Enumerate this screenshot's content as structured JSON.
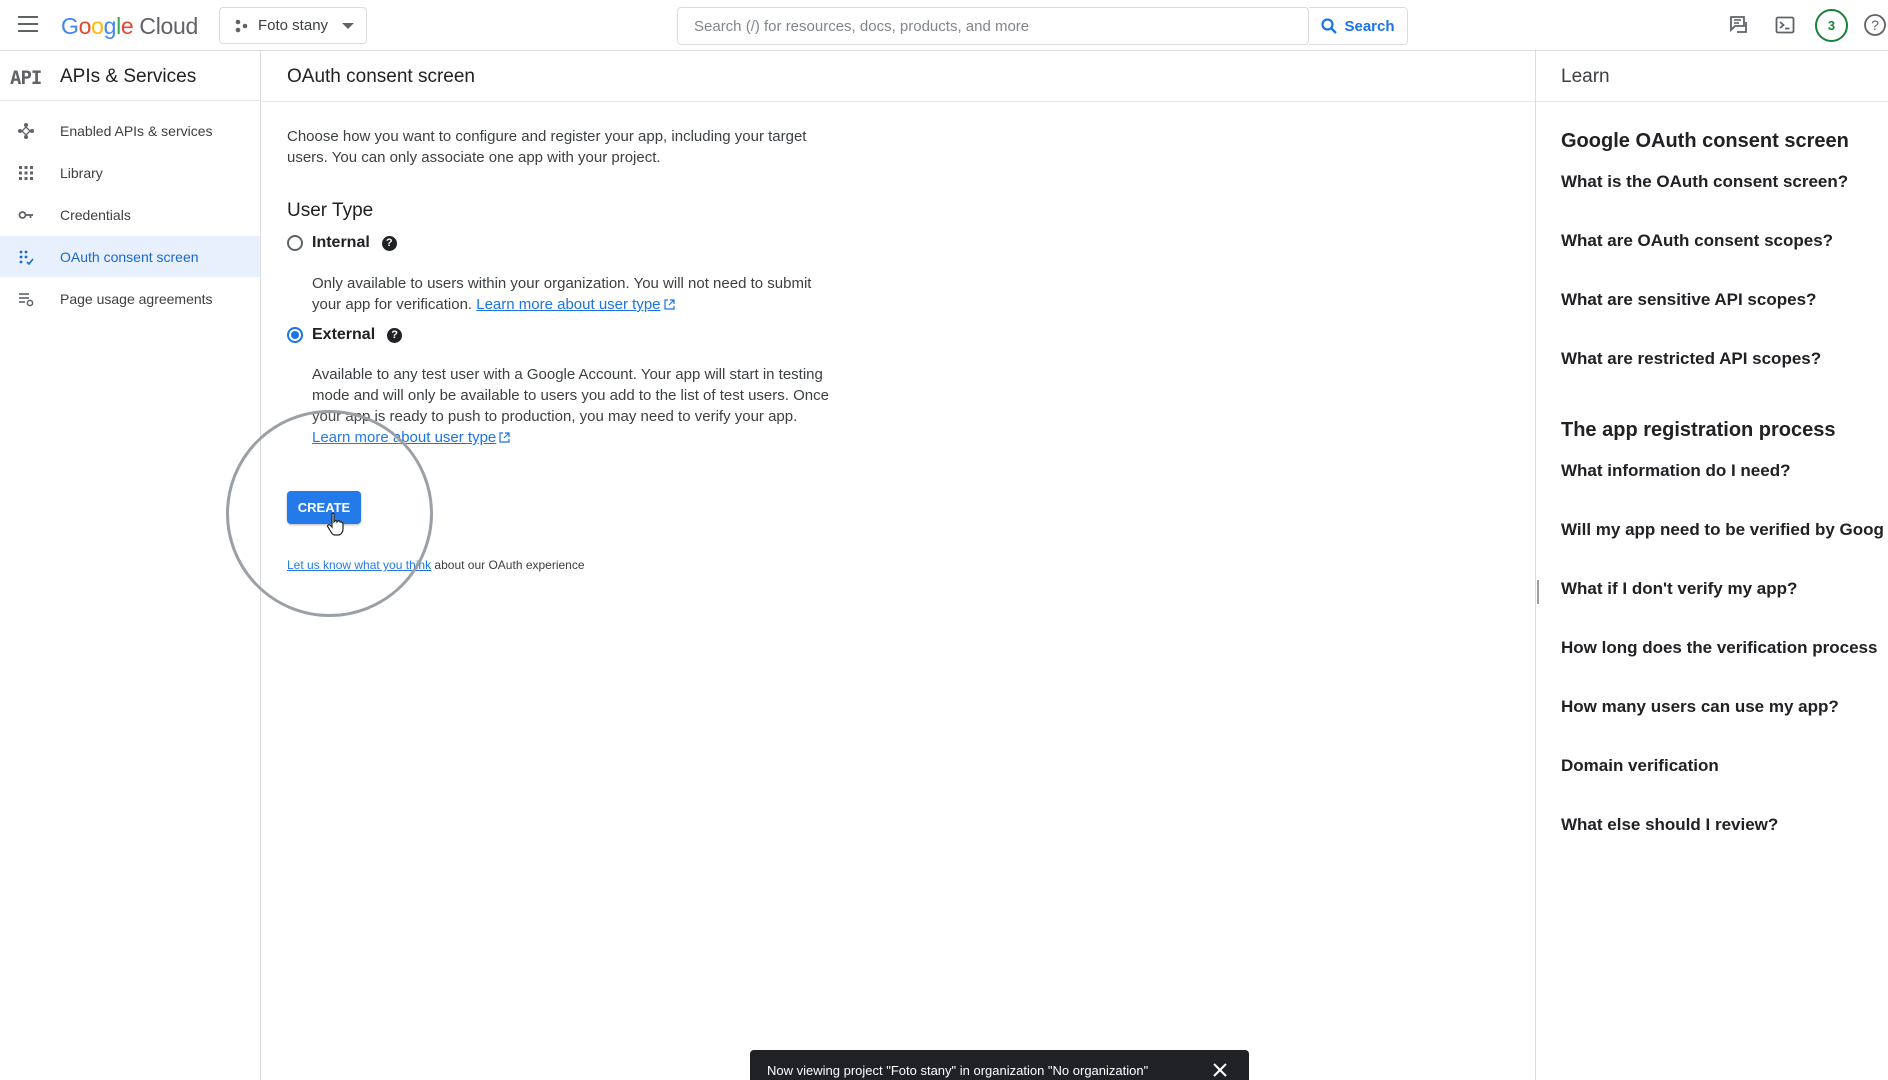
{
  "topbar": {
    "logo_google": [
      "G",
      "o",
      "o",
      "g",
      "l",
      "e"
    ],
    "logo_cloud": "Cloud",
    "project_name": "Foto stany",
    "search_placeholder": "Search (/) for resources, docs, products, and more",
    "search_button": "Search",
    "notification_count": "3"
  },
  "sidebar": {
    "api_icon": "API",
    "title": "APIs & Services",
    "items": [
      {
        "label": "Enabled APIs & services",
        "icon": "diamond-dots-icon"
      },
      {
        "label": "Library",
        "icon": "grid-icon"
      },
      {
        "label": "Credentials",
        "icon": "key-icon"
      },
      {
        "label": "OAuth consent screen",
        "icon": "consent-dots-icon",
        "active": true
      },
      {
        "label": "Page usage agreements",
        "icon": "settings-list-icon"
      }
    ]
  },
  "main": {
    "title": "OAuth consent screen",
    "intro": "Choose how you want to configure and register your app, including your target users. You can only associate one app with your project.",
    "user_type_title": "User Type",
    "internal": {
      "label": "Internal",
      "desc": "Only available to users within your organization. You will not need to submit your app for verification.",
      "link": "Learn more about user type",
      "checked": false
    },
    "external": {
      "label": "External",
      "desc": "Available to any test user with a Google Account. Your app will start in testing mode and will only be available to users you add to the list of test users. Once your app is ready to push to production, you may need to verify your app.",
      "link": "Learn more about user type",
      "checked": true
    },
    "create_button": "CREATE",
    "feedback_link": "Let us know what you think",
    "feedback_text": " about our OAuth experience"
  },
  "learn": {
    "title": "Learn",
    "section1": "Google OAuth consent screen",
    "section1_links": [
      "What is the OAuth consent screen?",
      "What are OAuth consent scopes?",
      "What are sensitive API scopes?",
      "What are restricted API scopes?"
    ],
    "section2": "The app registration process",
    "section2_links": [
      "What information do I need?",
      "Will my app need to be verified by Goog",
      "What if I don't verify my app?",
      "How long does the verification process",
      "How many users can use my app?",
      "Domain verification",
      "What else should I review?"
    ]
  },
  "snackbar": {
    "text": "Now viewing project \"Foto stany\" in organization \"No organization\""
  },
  "colors": {
    "accent": "#1a73e8",
    "active_bg": "#e8f0fe",
    "badge": "#188038"
  }
}
